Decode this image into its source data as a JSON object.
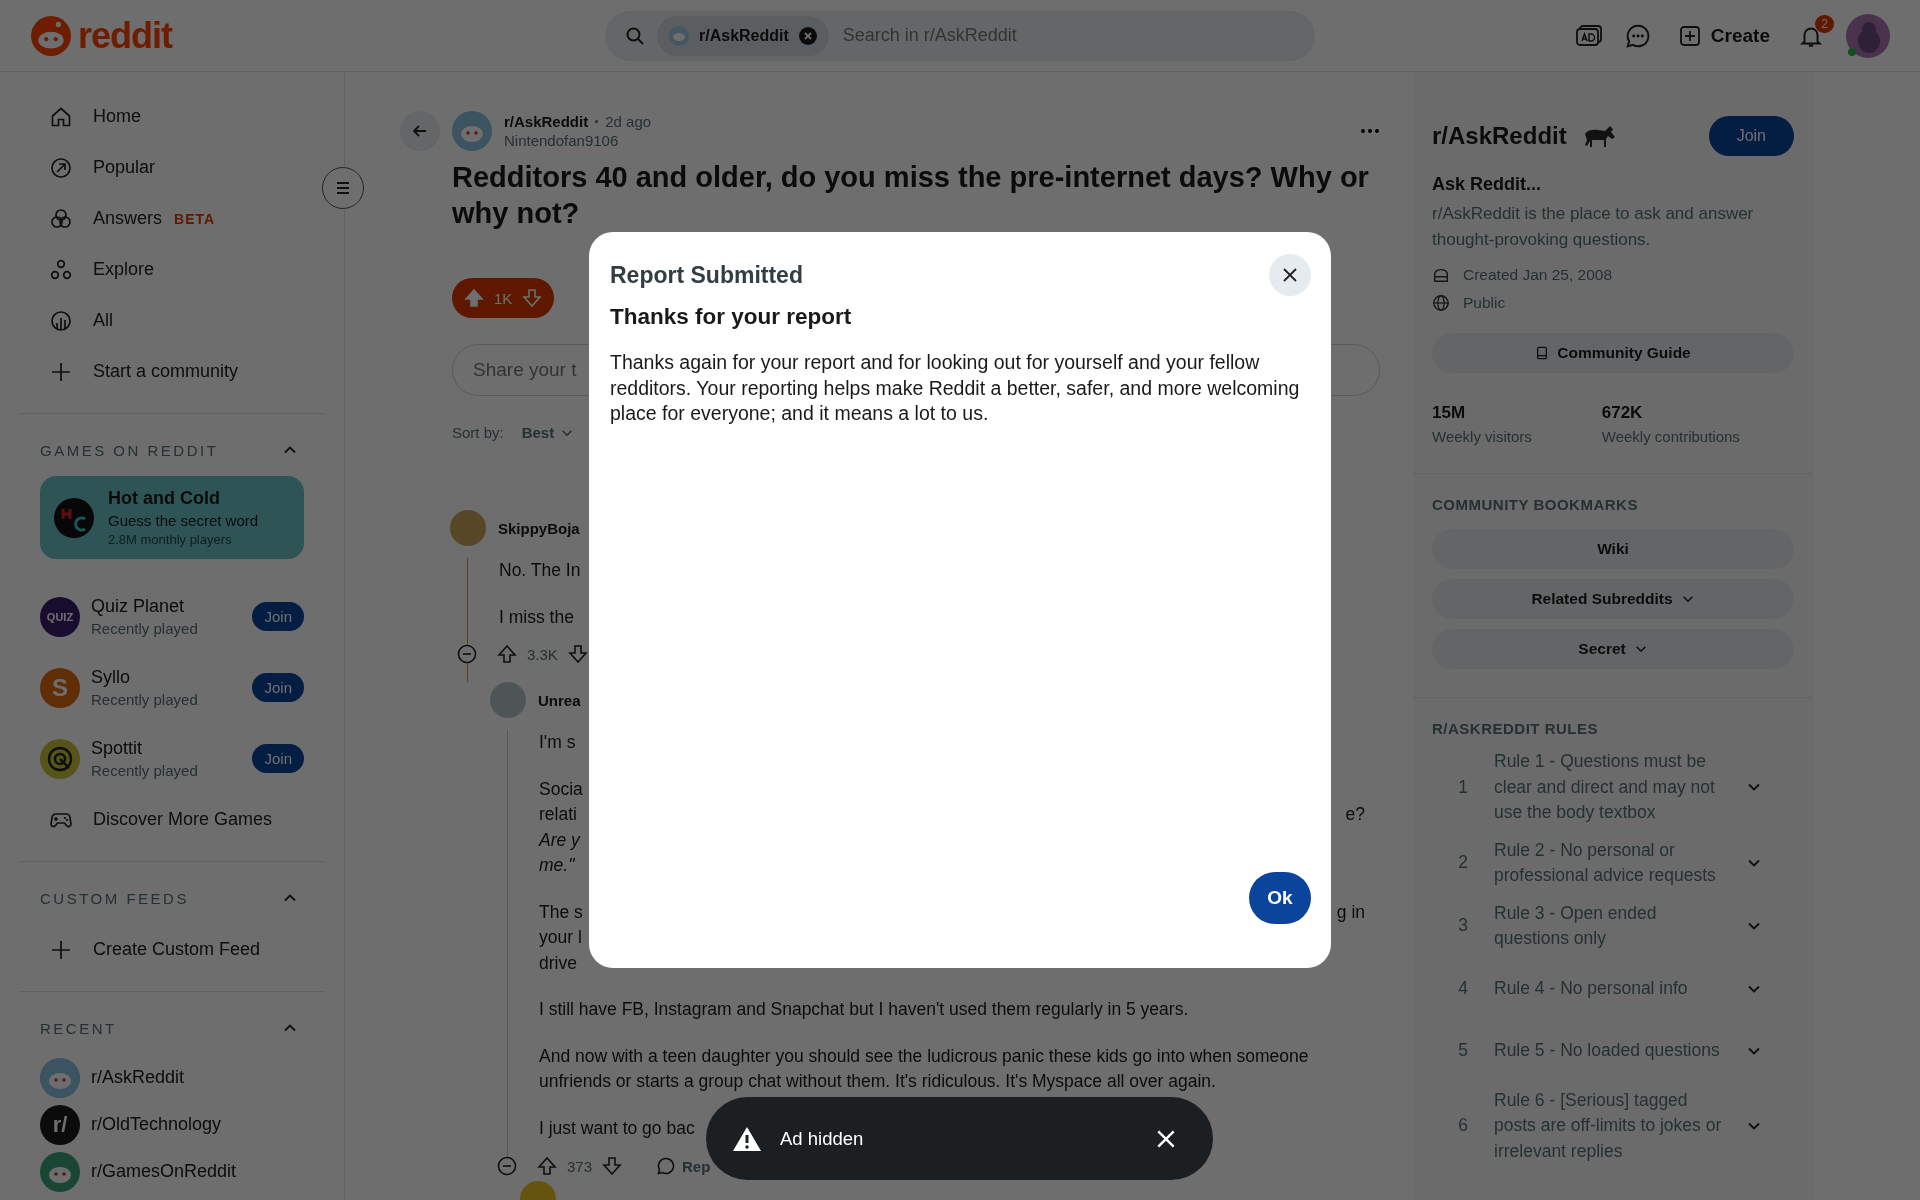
{
  "header": {
    "logo": "reddit",
    "search": {
      "chip": "r/AskReddit",
      "placeholder": "Search in r/AskReddit"
    },
    "create": "Create",
    "notifications": "2"
  },
  "nav": [
    {
      "label": "Home"
    },
    {
      "label": "Popular"
    },
    {
      "label": "Answers",
      "badge": "BETA"
    },
    {
      "label": "Explore"
    },
    {
      "label": "All"
    },
    {
      "label": "Start a community"
    }
  ],
  "games": {
    "heading": "GAMES ON REDDIT",
    "expanded": true,
    "featured": {
      "title": "Hot and Cold",
      "subtitle": "Guess the secret word",
      "players": "2.8M monthly players"
    },
    "items": [
      {
        "name": "Quiz Planet",
        "subtitle": "Recently played",
        "button": "Join",
        "logo_text": "QUIZ"
      },
      {
        "name": "Syllo",
        "subtitle": "Recently played",
        "button": "Join",
        "logo_text": "S"
      },
      {
        "name": "Spottit",
        "subtitle": "Recently played",
        "button": "Join"
      }
    ],
    "discover": "Discover More Games"
  },
  "custom_feeds": {
    "heading": "CUSTOM FEEDS",
    "expanded": true,
    "items": [
      "Create Custom Feed"
    ]
  },
  "recent": {
    "heading": "RECENT",
    "expanded": true,
    "items": [
      {
        "label": "r/AskReddit"
      },
      {
        "label": "r/OldTechnology",
        "logo_text": "r/"
      },
      {
        "label": "r/GamesOnReddit"
      }
    ]
  },
  "post": {
    "subreddit": "r/AskReddit",
    "time": "2d ago",
    "author": "Nintendofan9106",
    "title": "Redditors 40 and older, do you miss the pre-internet days? Why or why not?",
    "votes": "1K",
    "upvoted": true,
    "comment_placeholder": "Share your t",
    "sort_label": "Sort by:",
    "sort_value": "Best"
  },
  "comments": [
    {
      "author": "SkippyBoja",
      "votes": "3.3K",
      "paragraphs": [
        [
          {
            "text": "No. The In"
          }
        ],
        [
          {
            "text": "I miss the"
          }
        ]
      ]
    },
    {
      "author": "Unrea",
      "votes": "373",
      "reply": "Rep",
      "paragraphs": [
        [
          {
            "text": "I'm s"
          }
        ],
        [
          {
            "text": "Socia"
          },
          {
            "text": "relati",
            "right": "e?"
          },
          {
            "text": "Are y",
            "italic": true
          },
          {
            "text": "me.\"",
            "italic": true
          }
        ],
        [
          {
            "text": "The s",
            "right": "g in"
          },
          {
            "text": "your l"
          },
          {
            "text": "drive"
          }
        ],
        [
          {
            "text": "I still have FB, Instagram and Snapchat but I haven't used them regularly in 5 years."
          }
        ],
        [
          {
            "text": "And now with a teen daughter you should see the ludicrous panic these kids go into when someone"
          },
          {
            "text": "unfriends or starts a group chat without them. It's ridiculous. It's Myspace all over again."
          }
        ],
        [
          {
            "text": "I just want to go bac"
          }
        ]
      ]
    }
  ],
  "community": {
    "name": "r/AskReddit",
    "join": "Join",
    "title": "Ask Reddit...",
    "description": "r/AskReddit is the place to ask and answer thought-provoking questions.",
    "created": "Created Jan 25, 2008",
    "visibility": "Public",
    "guide": "Community Guide",
    "stats": [
      {
        "value": "15M",
        "label": "Weekly visitors"
      },
      {
        "value": "672K",
        "label": "Weekly contributions"
      }
    ],
    "bookmarks_heading": "COMMUNITY BOOKMARKS",
    "bookmarks": [
      {
        "label": "Wiki",
        "dropdown": false
      },
      {
        "label": "Related Subreddits",
        "dropdown": true
      },
      {
        "label": "Secret",
        "dropdown": true
      }
    ],
    "rules_heading": "R/ASKREDDIT RULES",
    "rules": [
      {
        "number": "1",
        "text": "Rule 1 - Questions must be clear and direct and may not use the body textbox",
        "expanded": false
      },
      {
        "number": "2",
        "text": "Rule 2 - No personal or professional advice requests",
        "expanded": false
      },
      {
        "number": "3",
        "text": "Rule 3 - Open ended questions only",
        "expanded": false
      },
      {
        "number": "4",
        "text": "Rule 4 - No personal info",
        "expanded": false
      },
      {
        "number": "5",
        "text": "Rule 5 - No loaded questions",
        "expanded": false
      },
      {
        "number": "6",
        "text": "Rule 6 - [Serious] tagged posts are off-limits to jokes or irrelevant replies",
        "expanded": false
      }
    ]
  },
  "modal": {
    "title": "Report Submitted",
    "subtitle": "Thanks for your report",
    "body": "Thanks again for your report and for looking out for yourself and your fellow redditors. Your reporting helps make Reddit a better, safer, and more welcoming place for everyone; and it means a lot to us.",
    "button": "Ok"
  },
  "toast": {
    "text": "Ad hidden"
  }
}
